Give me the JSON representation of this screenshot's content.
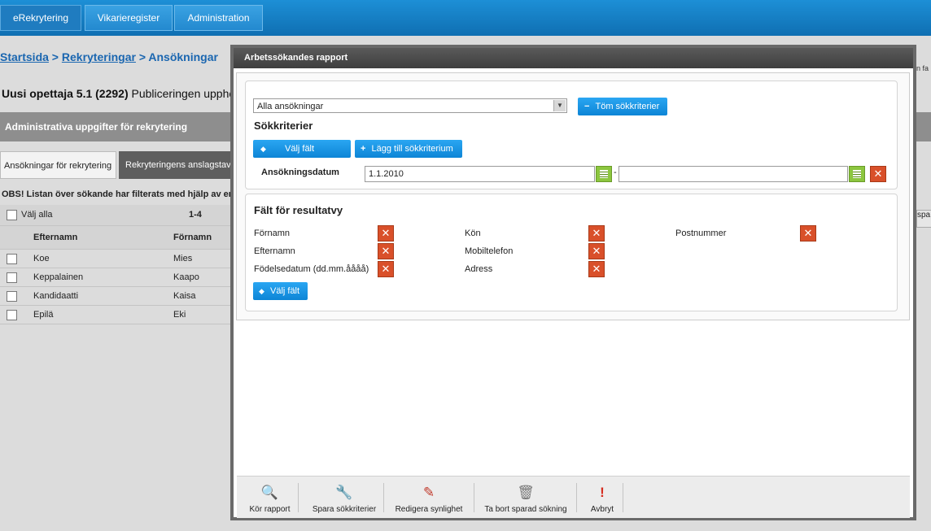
{
  "topnav": {
    "tabs": [
      "eRekrytering",
      "Vikarieregister",
      "Administration"
    ]
  },
  "background": {
    "breadcrumb": {
      "home": "Startsida",
      "sep1": " > ",
      "recruitments": "Rekryteringar",
      "sep2": " > ",
      "applications": "Ansökningar"
    },
    "job_title_bold": "Uusi opettaja 5.1 (2292)",
    "job_title_rest": " Publiceringen uppho",
    "gray_bar": "Administrativa uppgifter för rekrytering",
    "tabs": [
      "Ansökningar för rekrytering",
      "Rekryteringens anslagstavl"
    ],
    "notice": "OBS! Listan över sökande har filterats med hjälp av er",
    "select_all": "Välj alla",
    "range": "1-4",
    "columns": [
      "Efternamn",
      "Förnamn"
    ],
    "rows": [
      {
        "last": "Koe",
        "first": "Mies"
      },
      {
        "last": "Keppalainen",
        "first": "Kaapo"
      },
      {
        "last": "Kandidaatti",
        "first": "Kaisa"
      },
      {
        "last": "Epilä",
        "first": "Eki"
      }
    ],
    "right_clip_1": "n fa",
    "right_clip_2": "spa"
  },
  "modal": {
    "title": "Arbetssökandes rapport",
    "applications_select": "Alla ansökningar",
    "clear_criteria": "Töm sökkriterier",
    "criteria_title": "Sökkriterier",
    "choose_field": "Välj fält",
    "add_criterion": "Lägg till sökkriterium",
    "date_label": "Ansökningsdatum",
    "date_from": "1.1.2010",
    "date_to": "",
    "date_sep": "-",
    "results_title": "Fält för resultatvy",
    "result_fields": [
      "Förnamn",
      "Efternamn",
      "Födelsedatum (dd.mm.åååå)",
      "Kön",
      "Mobiltelefon",
      "Adress",
      "Postnummer"
    ],
    "choose_field_2": "Välj fält"
  },
  "toolbar": {
    "run_report": "Kör rapport",
    "save_criteria": "Spara sökkriterier",
    "edit_visibility": "Redigera synlighet",
    "delete_saved": "Ta bort sparad sökning",
    "cancel": "Avbryt"
  },
  "colors": {
    "accent": "#0d85d6",
    "remove": "#d9502a",
    "calendar": "#8cc63f"
  }
}
